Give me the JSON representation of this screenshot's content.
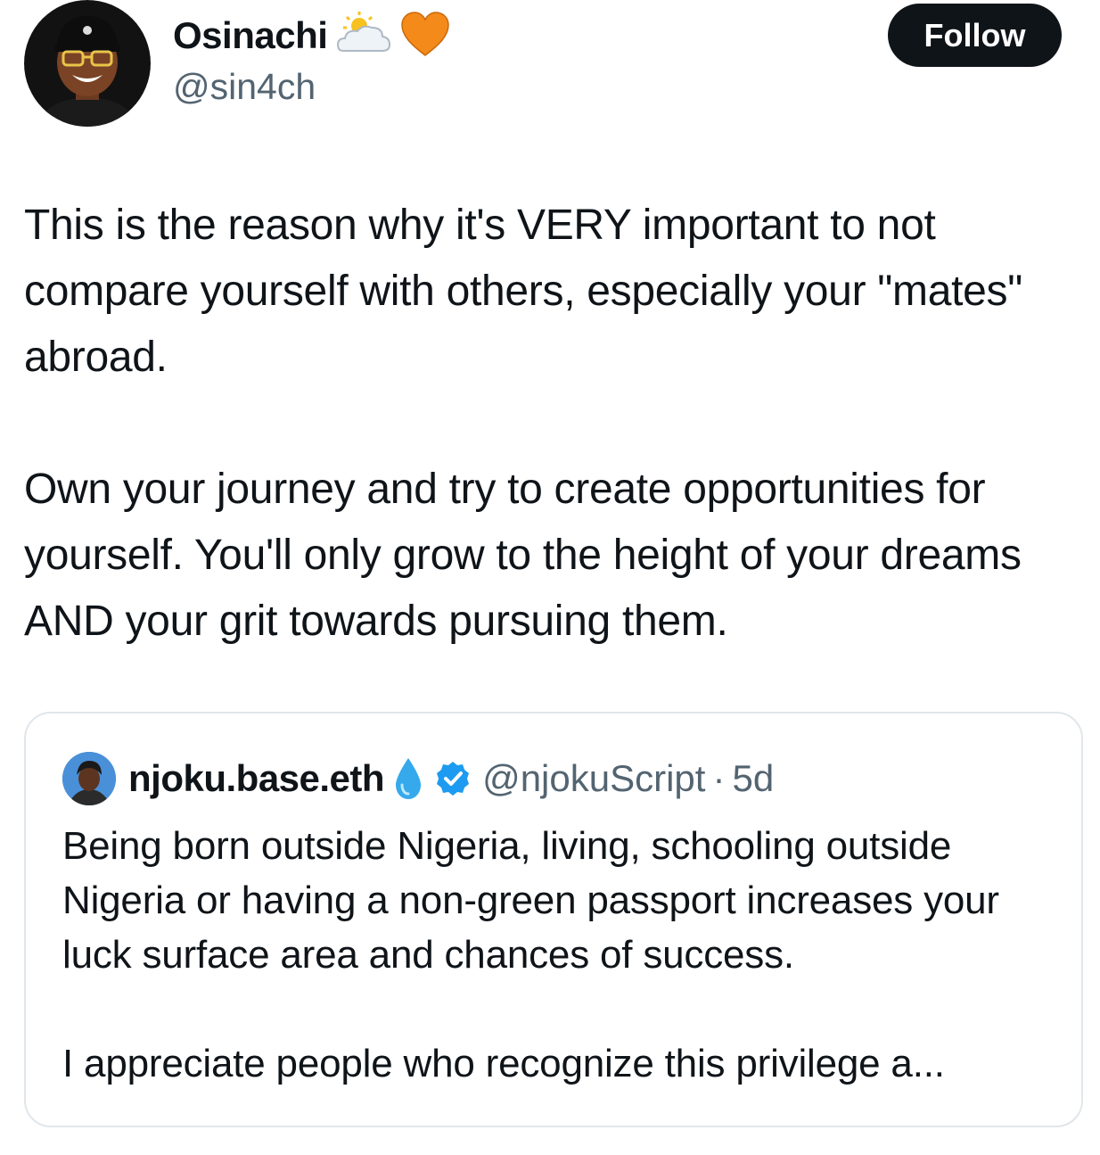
{
  "author": {
    "display_name": "Osinachi",
    "handle": "@sin4ch",
    "name_emojis": [
      "sun-behind-cloud-icon",
      "orange-heart-icon"
    ]
  },
  "follow_button": {
    "label": "Follow"
  },
  "tweet": {
    "paragraph_1": "This is the reason why it's VERY important to not compare yourself with others, especially your \"mates\" abroad.",
    "paragraph_2": "Own your journey and try to create opportunities for yourself. You'll only grow to the height of your dreams AND your grit towards pursuing them."
  },
  "quoted_tweet": {
    "display_name": "njoku.base.eth",
    "handle": "@njokuScript",
    "separator": "·",
    "time": "5d",
    "verified": true,
    "name_emoji": "droplet-icon",
    "paragraph_1": "Being born outside Nigeria, living, schooling outside Nigeria or having a non-green passport increases your luck surface area and chances of success.",
    "paragraph_2": "I appreciate people who recognize this privilege a..."
  },
  "colors": {
    "text_primary": "#0f1419",
    "text_secondary": "#536471",
    "follow_bg": "#0f1419",
    "verified_blue": "#1d9bf0",
    "card_border": "#e1e6ea"
  }
}
